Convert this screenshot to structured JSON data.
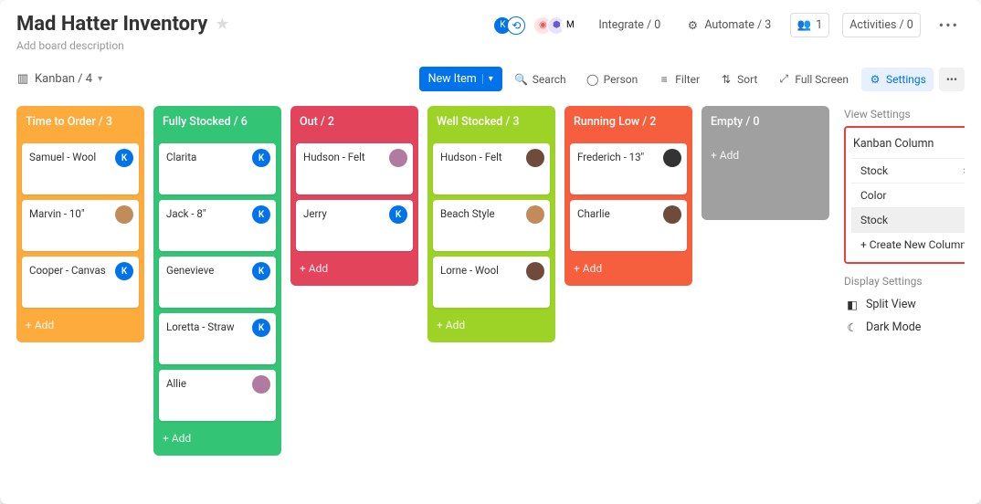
{
  "header": {
    "title": "Mad Hatter Inventory",
    "description": "Add board description",
    "integrate": "Integrate / 0",
    "automate": "Automate / 3",
    "people": "1",
    "activities": "Activities / 0"
  },
  "toolbar": {
    "view_label": "Kanban / 4",
    "new_item": "New Item",
    "search": "Search",
    "person": "Person",
    "filter": "Filter",
    "sort": "Sort",
    "fullscreen": "Full Screen",
    "settings": "Settings"
  },
  "columns": [
    {
      "title": "Time to Order / 3",
      "cards": [
        {
          "name": "Samuel - Wool",
          "avatar": "k"
        },
        {
          "name": "Marvin - 10\"",
          "avatar": "p3"
        },
        {
          "name": "Cooper - Canvas",
          "avatar": "k"
        }
      ]
    },
    {
      "title": "Fully Stocked / 6",
      "cards": [
        {
          "name": "Clarita",
          "avatar": "k"
        },
        {
          "name": "Jack - 8\"",
          "avatar": "k"
        },
        {
          "name": "Genevieve",
          "avatar": "k"
        },
        {
          "name": "Loretta - Straw",
          "avatar": "k"
        },
        {
          "name": "Allie",
          "avatar": "p1"
        }
      ]
    },
    {
      "title": "Out / 2",
      "cards": [
        {
          "name": "Hudson - Felt",
          "avatar": "p1"
        },
        {
          "name": "Jerry",
          "avatar": "k"
        }
      ]
    },
    {
      "title": "Well Stocked / 3",
      "cards": [
        {
          "name": "Hudson - Felt",
          "avatar": "p2"
        },
        {
          "name": "Beach Style",
          "avatar": "p3"
        },
        {
          "name": "Lorne - Wool",
          "avatar": "p2"
        }
      ]
    },
    {
      "title": "Running Low / 2",
      "cards": [
        {
          "name": "Frederich - 13\"",
          "avatar": "p4"
        },
        {
          "name": "Charlie",
          "avatar": "p2"
        }
      ]
    },
    {
      "title": "Empty / 0",
      "cards": []
    }
  ],
  "add_label": "+ Add",
  "side": {
    "view_settings": "View Settings",
    "kanban_column": "Kanban Column",
    "selected": "Stock",
    "opts": {
      "color": "Color",
      "stock": "Stock",
      "create": "+ Create New Column"
    },
    "display_settings": "Display Settings",
    "split_view": "Split View",
    "dark_mode": "Dark Mode"
  }
}
